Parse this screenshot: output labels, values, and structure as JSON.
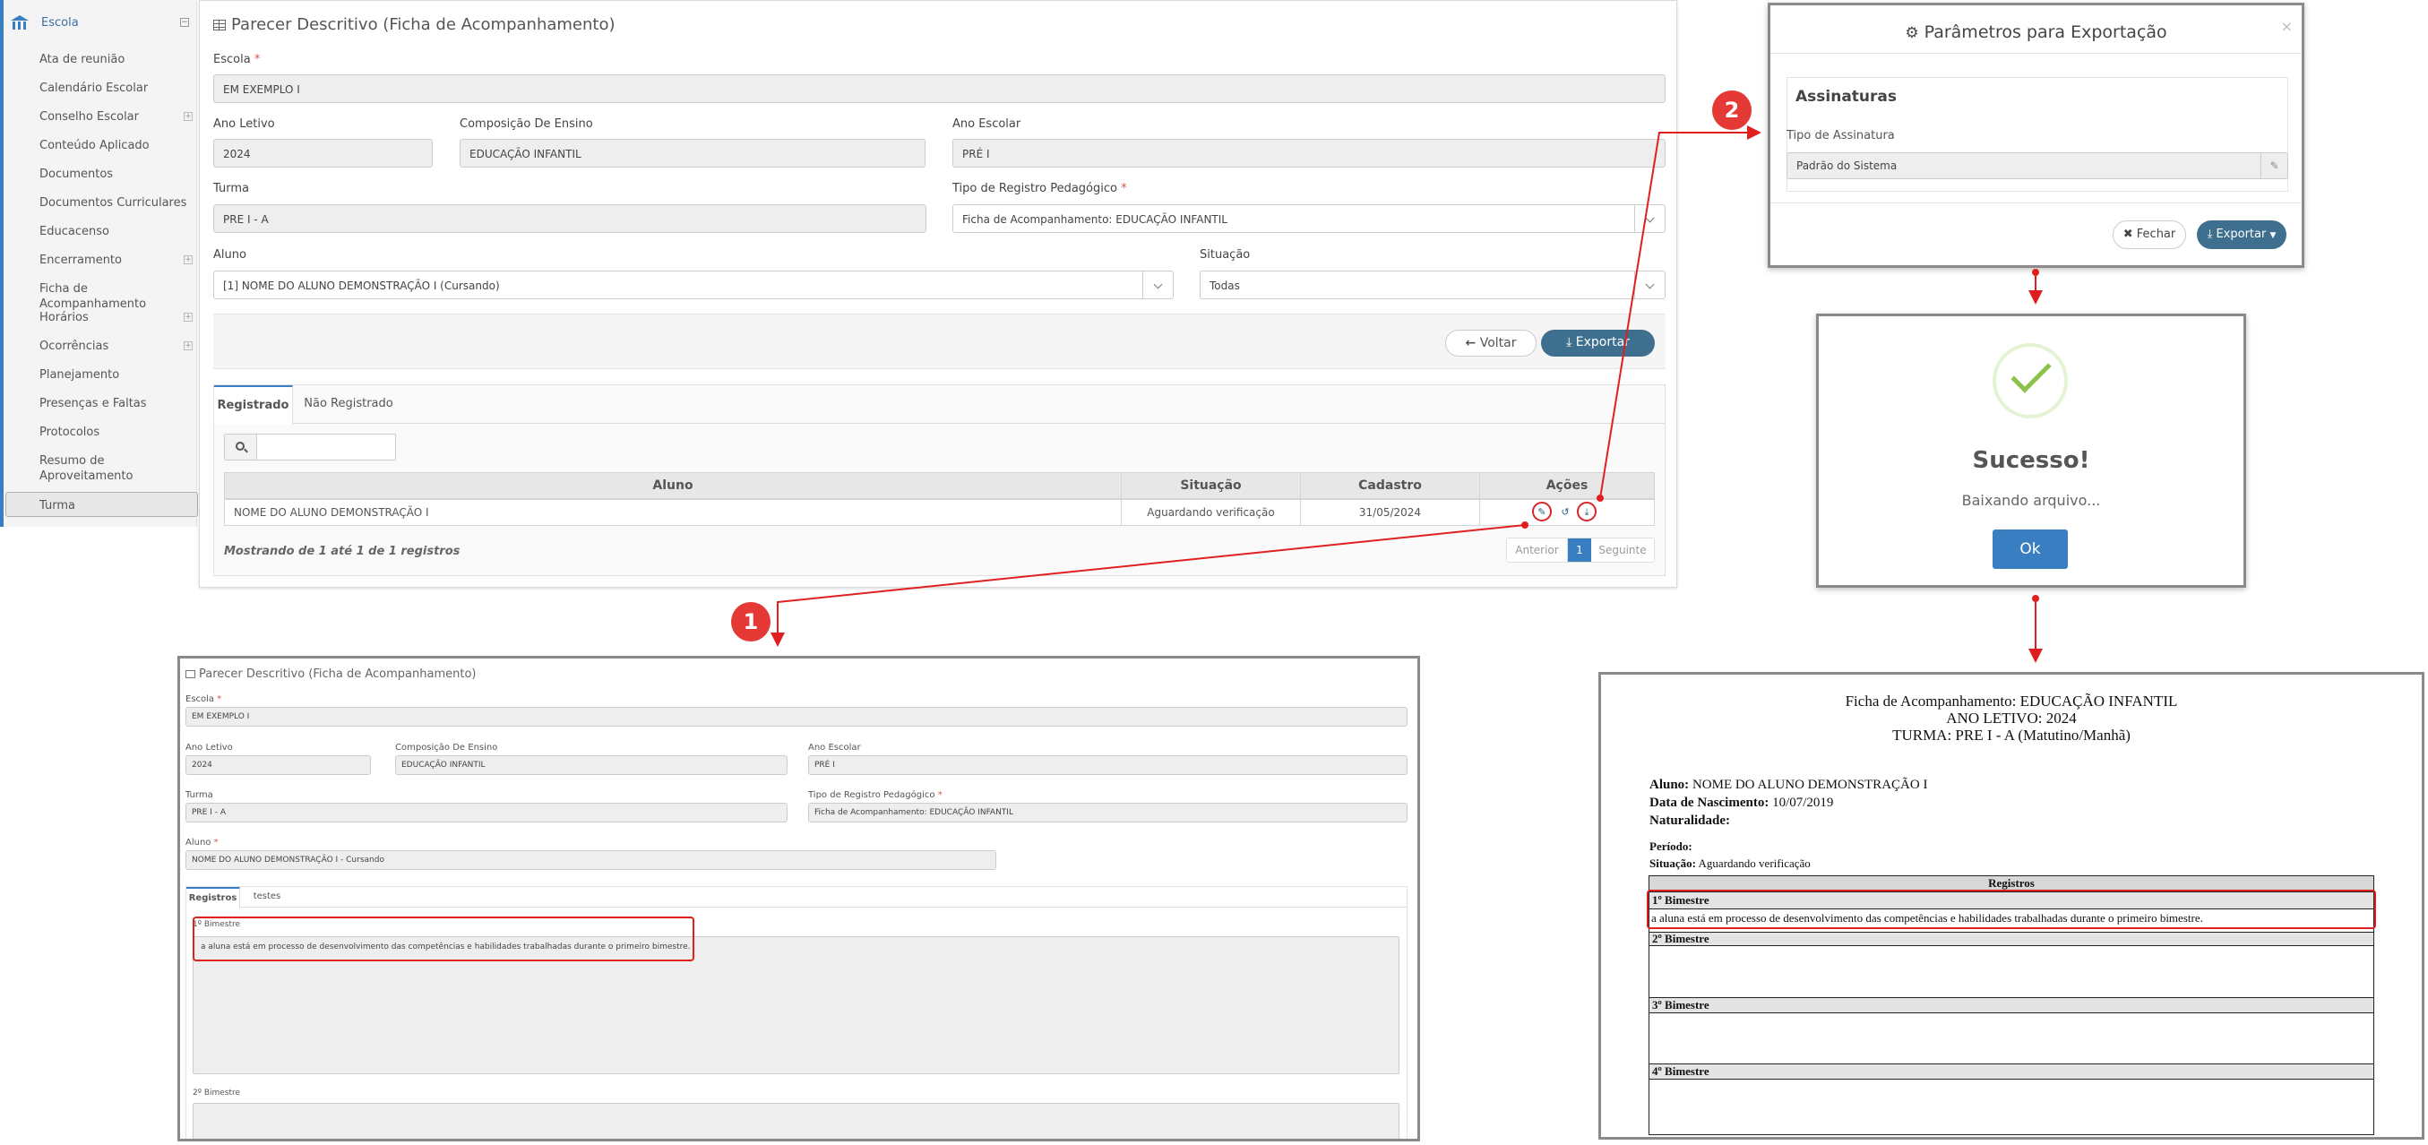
{
  "sidebar": {
    "header": "Escola",
    "items": [
      {
        "label": "Ata de reunião",
        "expand": false
      },
      {
        "label": "Calendário Escolar",
        "expand": false
      },
      {
        "label": "Conselho Escolar",
        "expand": true
      },
      {
        "label": "Conteúdo Aplicado",
        "expand": false
      },
      {
        "label": "Documentos",
        "expand": false
      },
      {
        "label": "Documentos Curriculares",
        "expand": false
      },
      {
        "label": "Educacenso",
        "expand": false
      },
      {
        "label": "Encerramento",
        "expand": true
      },
      {
        "label": "Ficha de Acompanhamento",
        "expand": false
      },
      {
        "label": "Horários",
        "expand": true
      },
      {
        "label": "Ocorrências",
        "expand": true
      },
      {
        "label": "Planejamento",
        "expand": false
      },
      {
        "label": "Presenças e Faltas",
        "expand": false
      },
      {
        "label": "Protocolos",
        "expand": false
      },
      {
        "label": "Resumo de Aproveitamento",
        "expand": false
      },
      {
        "label": "Turma",
        "expand": false
      }
    ]
  },
  "main": {
    "title": "Parecer Descritivo (Ficha de Acompanhamento)",
    "escola_label": "Escola",
    "escola_value": "EM EXEMPLO I",
    "ano_letivo_label": "Ano Letivo",
    "ano_letivo_value": "2024",
    "composicao_label": "Composição De Ensino",
    "composicao_value": "EDUCAÇÃO INFANTIL",
    "ano_escolar_label": "Ano Escolar",
    "ano_escolar_value": "PRÉ I",
    "turma_label": "Turma",
    "turma_value": "PRE I - A",
    "tipo_label": "Tipo de Registro Pedagógico",
    "tipo_value": "Ficha de Acompanhamento: EDUCAÇÃO INFANTIL",
    "aluno_label": "Aluno",
    "aluno_value": "[1] NOME DO ALUNO DEMONSTRAÇÃO I (Cursando)",
    "situacao_label": "Situação",
    "situacao_value": "Todas",
    "voltar": "Voltar",
    "exportar": "Exportar",
    "tabs": [
      "Registrado",
      "Não Registrado"
    ],
    "table": {
      "headers": [
        "Aluno",
        "Situação",
        "Cadastro",
        "Ações"
      ],
      "row": [
        "NOME DO ALUNO DEMONSTRAÇÃO I",
        "Aguardando verificação",
        "31/05/2024"
      ]
    },
    "footer": "Mostrando de 1 até 1 de 1 registros",
    "pagination": {
      "prev": "Anterior",
      "page": "1",
      "next": "Seguinte"
    }
  },
  "modal": {
    "title": "Parâmetros para Exportação",
    "section": "Assinaturas",
    "field_label": "Tipo de Assinatura",
    "field_value": "Padrão do Sistema",
    "close": "Fechar",
    "export": "Exportar"
  },
  "success": {
    "title": "Sucesso!",
    "message": "Baixando arquivo...",
    "ok": "Ok"
  },
  "detail": {
    "title": "Parecer Descritivo (Ficha de Acompanhamento)",
    "escola_label": "Escola",
    "escola_value": "EM EXEMPLO I",
    "ano_letivo_label": "Ano Letivo",
    "ano_letivo_value": "2024",
    "composicao_label": "Composição De Ensino",
    "composicao_value": "EDUCAÇÃO INFANTIL",
    "ano_escolar_label": "Ano Escolar",
    "ano_escolar_value": "PRÉ I",
    "turma_label": "Turma",
    "turma_value": "PRE I - A",
    "tipo_label": "Tipo de Registro Pedagógico",
    "tipo_value": "Ficha de Acompanhamento: EDUCAÇÃO INFANTIL",
    "aluno_label": "Aluno",
    "aluno_value": "NOME DO ALUNO DEMONSTRAÇÃO I - Cursando",
    "tabs": [
      "Registros",
      "testes"
    ],
    "bim1_label": "1º Bimestre",
    "bim1_text": "a aluna está em processo de desenvolvimento das competências e habilidades trabalhadas durante o primeiro bimestre.",
    "bim2_label": "2º Bimestre"
  },
  "report": {
    "title1": "Ficha de Acompanhamento: EDUCAÇÃO INFANTIL",
    "title2": "ANO LETIVO: 2024",
    "title3": "TURMA: PRE I - A (Matutino/Manhã)",
    "aluno_label": "Aluno:",
    "aluno_value": "NOME DO ALUNO DEMONSTRAÇÃO I",
    "nasc_label": "Data de Nascimento:",
    "nasc_value": "10/07/2019",
    "nat_label": "Naturalidade:",
    "periodo_label": "Período:",
    "situacao_label": "Situação:",
    "situacao_value": "Aguardando verificação",
    "registros": "Registros",
    "bim1": "1º Bimestre",
    "bim1_text": "a aluna está em processo de desenvolvimento das competências e habilidades trabalhadas durante o primeiro bimestre.",
    "bim2": "2º Bimestre",
    "bim3": "3º Bimestre",
    "bim4": "4º Bimestre"
  },
  "steps": [
    "1",
    "2"
  ],
  "colors": {
    "accent": "#3a7ec2",
    "primary_button": "#3f6f8e",
    "highlight": "#e02020",
    "success": "#8bc34a"
  }
}
